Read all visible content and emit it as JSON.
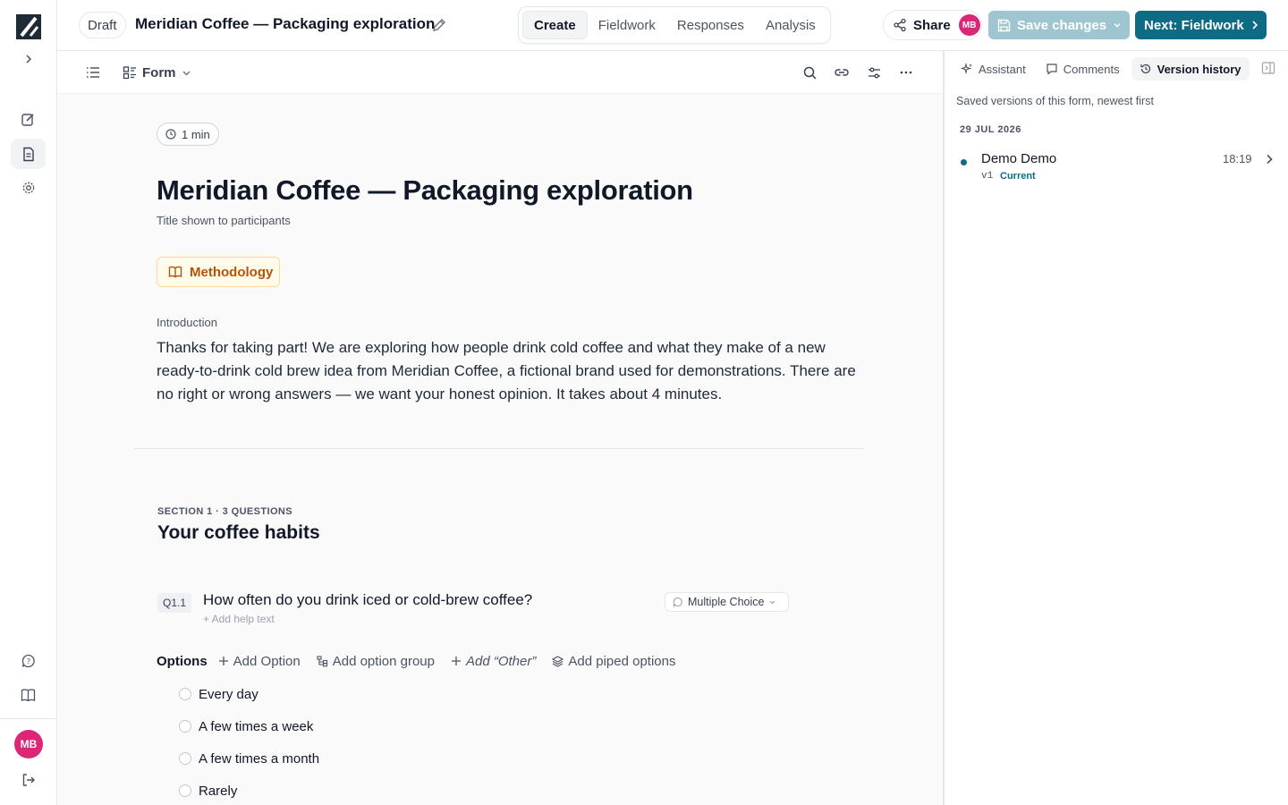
{
  "app": {
    "user_initials": "MB"
  },
  "header": {
    "status_badge": "Draft",
    "title": "Meridian Coffee — Packaging exploration",
    "tabs": [
      {
        "label": "Create",
        "active": true
      },
      {
        "label": "Fieldwork",
        "active": false
      },
      {
        "label": "Responses",
        "active": false
      },
      {
        "label": "Analysis",
        "active": false
      }
    ],
    "share_label": "Share",
    "save_label": "Save changes",
    "next_label": "Next: Fieldwork"
  },
  "toolbar": {
    "view_label": "Form"
  },
  "form": {
    "duration": "1 min",
    "title": "Meridian Coffee — Packaging exploration",
    "title_hint": "Title shown to participants",
    "methodology_label": "Methodology",
    "intro_label": "Introduction",
    "intro_text": "Thanks for taking part! We are exploring how people drink cold coffee and what they make of a new ready-to-drink cold brew idea from Meridian Coffee, a fictional brand used for demonstrations. There are no right or wrong answers — we want your honest opinion. It takes about 4 minutes."
  },
  "section": {
    "label": "SECTION 1 · 3 QUESTIONS",
    "title": "Your coffee habits",
    "question": {
      "number": "Q1.1",
      "text": "How often do you drink iced or cold-brew coffee?",
      "help_placeholder": "+ Add help text",
      "type": "Multiple Choice",
      "options_label": "Options",
      "actions": {
        "add_option": "Add Option",
        "add_group": "Add option group",
        "add_other": "Add “Other”",
        "add_piped": "Add piped options"
      },
      "options": [
        "Every day",
        "A few times a week",
        "A few times a month",
        "Rarely"
      ]
    }
  },
  "panel": {
    "tabs": [
      {
        "label": "Assistant",
        "active": false
      },
      {
        "label": "Comments",
        "active": false
      },
      {
        "label": "Version history",
        "active": true
      }
    ],
    "description": "Saved versions of this form, newest first",
    "date_group": "29 JUL 2026",
    "versions": [
      {
        "author": "Demo Demo",
        "version": "v1",
        "status": "Current",
        "time": "18:19"
      }
    ]
  },
  "colors": {
    "accent": "#0e6b84",
    "avatar": "#db2777",
    "save_disabled": "#9fc5d1",
    "methodology": "#b45309"
  }
}
